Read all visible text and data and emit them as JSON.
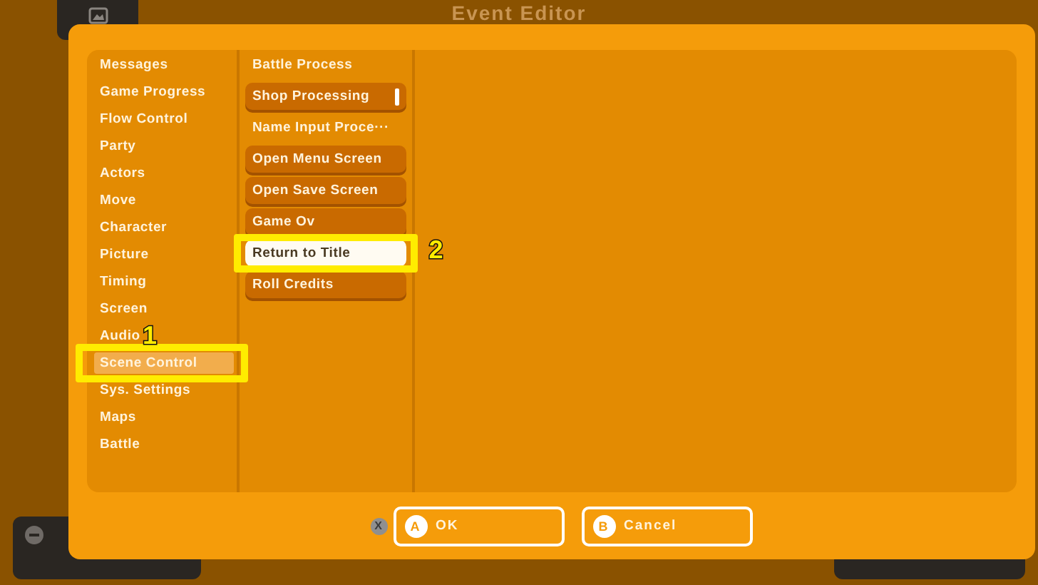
{
  "background": {
    "title": "Event Editor"
  },
  "categories": [
    {
      "label": "Messages",
      "selected": false
    },
    {
      "label": "Game Progress",
      "selected": false
    },
    {
      "label": "Flow Control",
      "selected": false
    },
    {
      "label": "Party",
      "selected": false
    },
    {
      "label": "Actors",
      "selected": false
    },
    {
      "label": "Move",
      "selected": false
    },
    {
      "label": "Character",
      "selected": false
    },
    {
      "label": "Picture",
      "selected": false
    },
    {
      "label": "Timing",
      "selected": false
    },
    {
      "label": "Screen",
      "selected": false
    },
    {
      "label": "Audio",
      "selected": false
    },
    {
      "label": "Scene Control",
      "selected": true,
      "callout": "1"
    },
    {
      "label": "Sys. Settings",
      "selected": false
    },
    {
      "label": "Maps",
      "selected": false
    },
    {
      "label": "Battle",
      "selected": false
    }
  ],
  "commands": [
    {
      "kind": "text",
      "label": "Battle Process"
    },
    {
      "kind": "button",
      "label": "Shop Processing",
      "selected": false,
      "marker": true
    },
    {
      "kind": "text",
      "label": "Name Input Proce···"
    },
    {
      "kind": "button",
      "label": "Open Menu Screen",
      "selected": false,
      "marker": false
    },
    {
      "kind": "button",
      "label": "Open Save Screen",
      "selected": false,
      "marker": false
    },
    {
      "kind": "button",
      "label": "Game Ov",
      "selected": false,
      "marker": false
    },
    {
      "kind": "button",
      "label": "Return to Title",
      "selected": true,
      "marker": false,
      "callout": "2"
    },
    {
      "kind": "button",
      "label": "Roll Credits",
      "selected": false,
      "marker": false
    }
  ],
  "footer": {
    "hint_key": "X",
    "buttons": [
      {
        "key": "A",
        "label": "OK"
      },
      {
        "key": "B",
        "label": "Cancel"
      }
    ]
  }
}
